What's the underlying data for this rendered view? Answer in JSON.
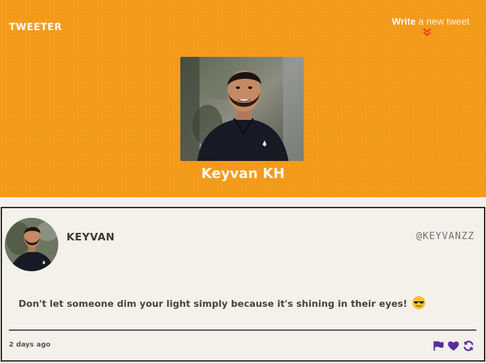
{
  "header": {
    "brand": "TWEETER",
    "write_link": {
      "strong": "Write",
      "rest": " a new tweet"
    },
    "icons": {
      "write_chevron": "chevron-double-down-icon"
    },
    "profile": {
      "name": "Keyvan KH"
    },
    "colors": {
      "background": "#f49a19",
      "chevron": "#e8491d"
    }
  },
  "tweet": {
    "display_name": "KEYVAN",
    "handle": "@KEYVANZZ",
    "text": "Don't let someone dim your light simply because it's shining in their eyes!",
    "emoji": "smiling-face-with-sunglasses",
    "timestamp": "2 days ago",
    "actions": [
      "flag-icon",
      "heart-icon",
      "retweet-icon"
    ],
    "colors": {
      "action": "#5a2ca0",
      "divider": "#4d5563"
    }
  }
}
